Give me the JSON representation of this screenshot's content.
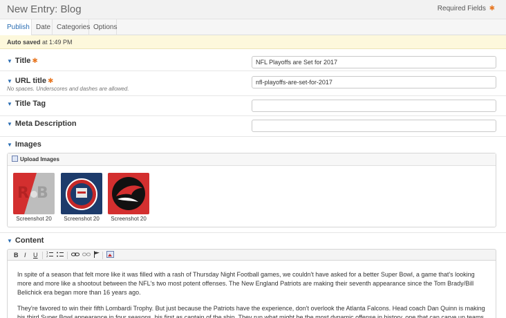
{
  "header": {
    "title": "New Entry: Blog",
    "required_label": "Required Fields",
    "required_star": "✱"
  },
  "tabs": [
    {
      "label": "Publish",
      "active": true
    },
    {
      "label": "Date",
      "active": false
    },
    {
      "label": "Categories",
      "active": false
    },
    {
      "label": "Options",
      "active": false
    }
  ],
  "autosave": {
    "bold": "Auto saved",
    "time": "at 1:49 PM"
  },
  "fields": {
    "title": {
      "label": "Title",
      "value": "NFL Playoffs are Set for 2017"
    },
    "url_title": {
      "label": "URL title",
      "note": "No spaces. Underscores and dashes are allowed.",
      "value": "nfl-playoffs-are-set-for-2017"
    },
    "title_tag": {
      "label": "Title Tag",
      "value": ""
    },
    "meta_description": {
      "label": "Meta Description",
      "value": ""
    }
  },
  "images": {
    "label": "Images",
    "upload_label": "Upload Images",
    "items": [
      {
        "caption": "Screenshot 20",
        "bg": "#c8c8c8",
        "accent": "#d32f2f"
      },
      {
        "caption": "Screenshot 20",
        "bg": "#1d3b6b",
        "accent": "#c62828"
      },
      {
        "caption": "Screenshot 20",
        "bg": "#d32f2f",
        "accent": "#111111"
      }
    ]
  },
  "content": {
    "label": "Content",
    "toolbar": [
      "B",
      "I",
      "U",
      "ol-icon",
      "ul-icon",
      "link-icon",
      "unlink-icon",
      "flag-icon",
      "image-icon"
    ],
    "paragraphs": [
      "In spite of a season that felt more like it was filled with a rash of Thursday Night Football games, we couldn't have asked for a better Super Bowl, a game that's looking more and more like a shootout between the NFL's two most potent offenses. The New England Patriots are making their seventh appearance since the Tom Brady/Bill Belichick era began more than 16 years ago.",
      "They're favored to win their fifth Lombardi Trophy. But just because the Patriots have the experience, don't overlook the Atlanta Falcons. Head coach Dan Quinn is making his third Super Bowl appearance in four seasons, his first as captain of the ship. They run what might be the most dynamic offense in history, one that can carve up teams any way they choose. We've waited a long time for a game like this."
    ]
  },
  "colors": {
    "accent": "#2a6db3",
    "required": "#e87722",
    "autosave_bg": "#fdf8dc"
  }
}
